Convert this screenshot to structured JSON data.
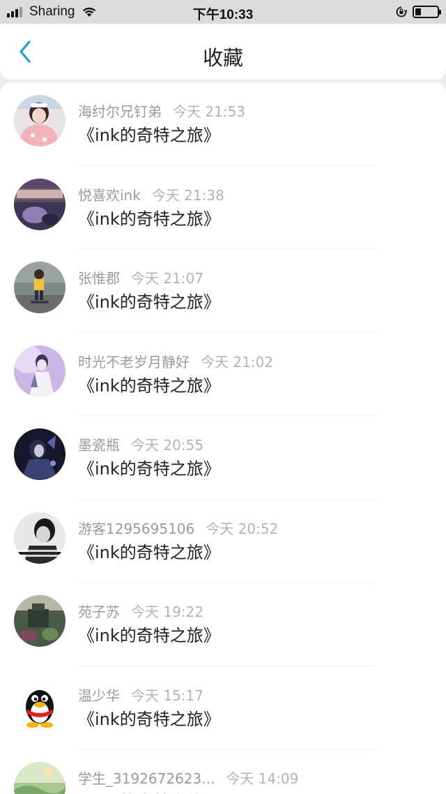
{
  "status_bar": {
    "carrier": "Sharing",
    "time": "下午10:33",
    "icons": [
      "signal-icon",
      "wifi-icon",
      "rotation-lock-icon",
      "battery-icon"
    ],
    "battery_level": 0.2
  },
  "nav": {
    "title": "收藏",
    "back_icon": "chevron-left-icon",
    "accent": "#1a9de8"
  },
  "favorites": [
    {
      "user": "海纣尔兄钉弟",
      "time": "今天 21:53",
      "work": "《ink的奇特之旅》"
    },
    {
      "user": "悦喜欢ink",
      "time": "今天 21:38",
      "work": "《ink的奇特之旅》"
    },
    {
      "user": "张惟郡",
      "time": "今天 21:07",
      "work": "《ink的奇特之旅》"
    },
    {
      "user": "时光不老岁月静好",
      "time": "今天 21:02",
      "work": "《ink的奇特之旅》"
    },
    {
      "user": "墨瓷瓶",
      "time": "今天 20:55",
      "work": "《ink的奇特之旅》"
    },
    {
      "user": "游客1295695106",
      "time": "今天 20:52",
      "work": "《ink的奇特之旅》"
    },
    {
      "user": "苑子苏",
      "time": "今天 19:22",
      "work": "《ink的奇特之旅》"
    },
    {
      "user": "温少华",
      "time": "今天 15:17",
      "work": "《ink的奇特之旅》"
    },
    {
      "user": "学生_3192672623...",
      "time": "今天 14:09",
      "work": "《ink的奇特之旅》"
    }
  ]
}
